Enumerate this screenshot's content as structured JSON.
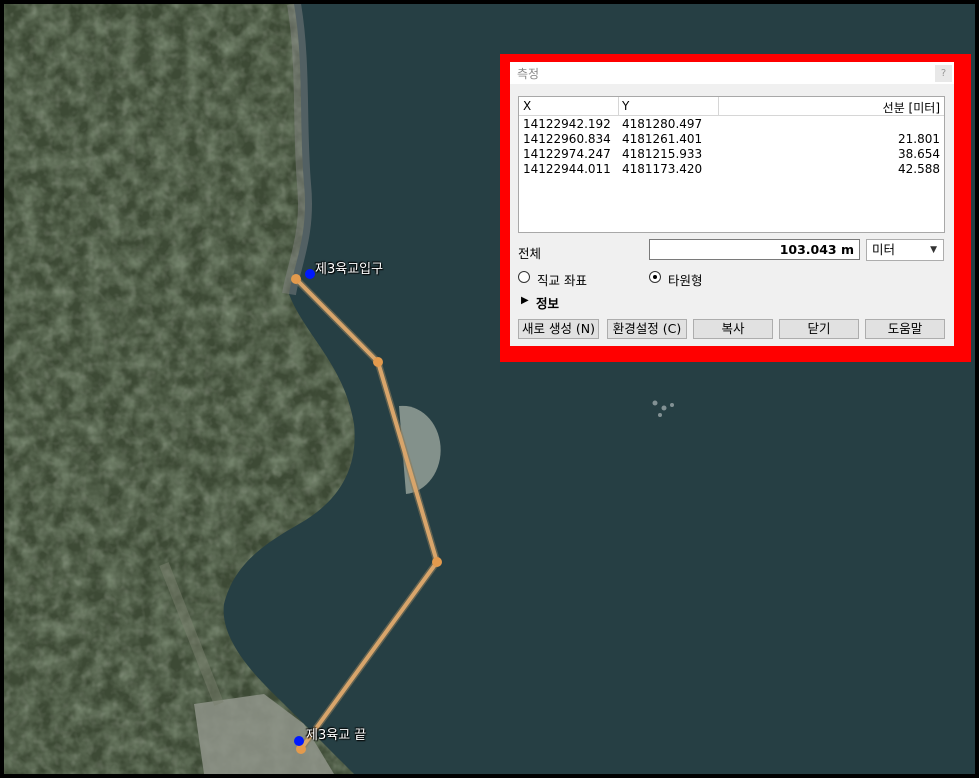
{
  "map": {
    "labels": {
      "start": "제3육교입구",
      "end": "제3육교 끝"
    },
    "colors": {
      "water": "#263f44",
      "route": "#d8a56b",
      "vertex": "#e39a4d",
      "marker": "#0019ff"
    }
  },
  "dialog": {
    "title": "측정",
    "title_button": "?",
    "table": {
      "columns": [
        "X",
        "Y",
        "선분 [미터]"
      ],
      "rows": [
        {
          "x": "14122942.192",
          "y": "4181280.497",
          "segment": ""
        },
        {
          "x": "14122960.834",
          "y": "4181261.401",
          "segment": "21.801"
        },
        {
          "x": "14122974.247",
          "y": "4181215.933",
          "segment": "38.654"
        },
        {
          "x": "14122944.011",
          "y": "4181173.420",
          "segment": "42.588"
        }
      ]
    },
    "total_label": "전체",
    "total_value": "103.043 m",
    "unit_selected": "미터",
    "radio_cartesian": "직교 좌표",
    "radio_ellipsoidal": "타원형",
    "info_toggle": "정보",
    "buttons": {
      "new": "새로 생성 (N)",
      "settings": "환경설정 (C)",
      "copy": "복사",
      "close": "닫기",
      "help": "도움말"
    },
    "highlight_color": "#ff0000"
  }
}
